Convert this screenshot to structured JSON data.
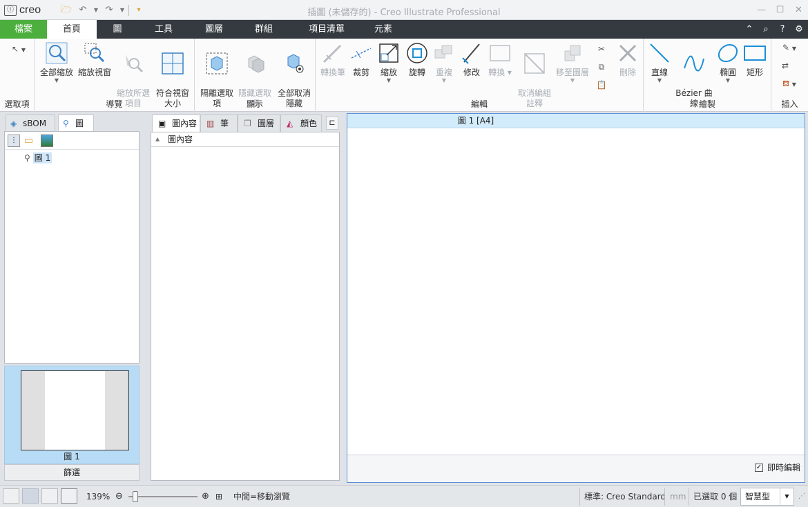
{
  "app": {
    "logo_text": "creo",
    "window_title": "插圖 (未儲存的) - Creo Illustrate Professional"
  },
  "menu": {
    "tabs": [
      "檔案",
      "首頁",
      "圖",
      "工具",
      "圖層",
      "群組",
      "項目清單",
      "元素"
    ],
    "active": "首頁"
  },
  "ribbon": {
    "groups": {
      "select": "選取項",
      "navigate": "導覽",
      "display": "顯示",
      "edit": "編輯",
      "draw": "繪製",
      "insert": "插入"
    },
    "buttons": {
      "zoom_all": "全部縮放",
      "zoom_window": "縮放視窗",
      "zoom_selected": "縮放所選\n項目",
      "fit_window": "符合視窗\n大小",
      "isolate": "隔離選取\n項",
      "hide_selected": "隱藏選取\n項",
      "unhide_all": "全部取消\n隱藏",
      "convert_pen": "轉換筆",
      "crop": "裁剪",
      "scale": "縮放",
      "rotate": "旋轉",
      "repeat": "重複",
      "modify": "修改",
      "convert": "轉換",
      "ungroup_annot": "取消編組\n註釋",
      "move_to_layer": "移至圖層",
      "delete": "刪除",
      "line": "直線",
      "bezier": "Bézier 曲\n線",
      "ellipse": "橢圓",
      "rectangle": "矩形"
    }
  },
  "left_panel": {
    "tabs": [
      "sBOM",
      "圖"
    ],
    "tree_item": "圖 1",
    "preview_label": "圖 1",
    "filter_label": "篩選"
  },
  "middle_panel": {
    "tabs": [
      "圖內容",
      "筆",
      "圖層",
      "顏色"
    ],
    "column_header": "圖內容"
  },
  "canvas": {
    "title": "圖 1 [A4]",
    "live_edit_label": "即時編輯",
    "live_edit_checked": true
  },
  "status": {
    "zoom": "139%",
    "zoom_fraction": 0.1,
    "hint": "中間=移動瀏覽",
    "standard": "標準: Creo Standard",
    "unit": "mm",
    "selected": "已選取 0 個",
    "mode": "智慧型"
  },
  "colors": {
    "menubar": "#343a40",
    "file_tab": "#4caf3d",
    "accent": "#1b8fd6",
    "canvas_header": "#d2ecfb"
  }
}
